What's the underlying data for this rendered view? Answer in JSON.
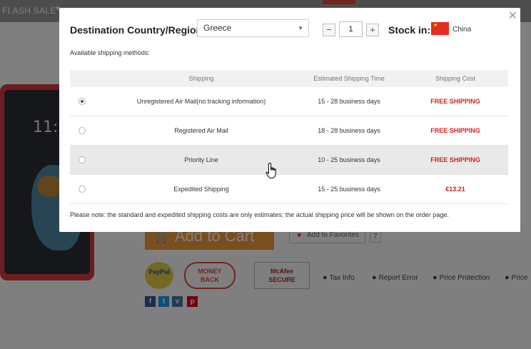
{
  "background": {
    "nav": {
      "flash_sale": "FLASH SALE"
    },
    "buttons": {
      "add_to_cart": "Add to Cart",
      "add_to_favorites": "Add to Favorites",
      "favorites_count": "7"
    },
    "badges": {
      "paypal": "PayPal",
      "money_back_1": "MONEY",
      "money_back_2": "BACK",
      "mcafee_1": "McAfee",
      "mcafee_2": "SECURE"
    },
    "links": {
      "tax_info": "Tax Info",
      "report_error": "Report Error",
      "price_protection": "Price Protection",
      "price_cut": "Price"
    },
    "phone": {
      "time": "11:3"
    }
  },
  "modal": {
    "destination_label": "Destination Country/Region:",
    "country": "Greece",
    "quantity": "1",
    "minus": "−",
    "plus": "+",
    "stock_label": "Stock in:",
    "stock_country": "China",
    "available_label": "Available shipping methods:",
    "columns": {
      "shipping": "Shipping",
      "time": "Estimated Shipping Time",
      "cost": "Shipping Cost"
    },
    "methods": [
      {
        "name": "Unregistered Air Mail(no tracking information)",
        "time": "15 - 28 business days",
        "cost": "FREE SHIPPING",
        "selected": true
      },
      {
        "name": "Registered Air Mail",
        "time": "18 - 28 business days",
        "cost": "FREE SHIPPING",
        "selected": false
      },
      {
        "name": "Priority Line",
        "time": "10 - 25 business days",
        "cost": "FREE SHIPPING",
        "selected": false
      },
      {
        "name": "Expedited Shipping",
        "time": "15 - 25 business days",
        "cost": "€13.21",
        "selected": false
      }
    ],
    "note": "Please note: the standard and expedited shipping costs are only estimates; the actual shipping price will be shown on the order page."
  },
  "colors": {
    "accent_orange": "#f29f3d",
    "price_red": "#d42020",
    "overlay": "rgba(0,0,0,0.5)"
  },
  "icons": {
    "close": "close-icon",
    "cart": "cart-icon",
    "heart": "heart-icon",
    "flag": "china-flag-icon",
    "cursor": "hand-pointer-icon"
  }
}
